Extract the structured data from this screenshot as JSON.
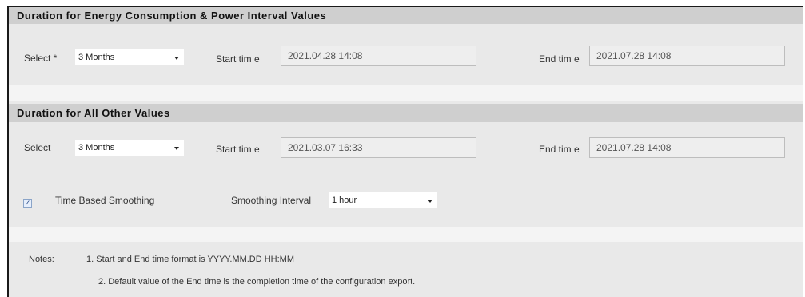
{
  "section1": {
    "title": "Duration for Energy Consumption & Power Interval Values",
    "select_label": "Select *",
    "select_value": "3 Months",
    "start_label": "Start tim e",
    "start_value": "2021.04.28 14:08",
    "end_label": "End tim e",
    "end_value": "2021.07.28 14:08"
  },
  "section2": {
    "title": "Duration for All Other Values",
    "select_label": "Select",
    "select_value": "3 Months",
    "start_label": "Start tim e",
    "start_value": "2021.03.07 16:33",
    "end_label": "End tim e",
    "end_value": "2021.07.28 14:08",
    "smoothing_checkbox_label": "Time Based Smoothing",
    "smoothing_checked": true,
    "smoothing_interval_label": "Smoothing Interval",
    "smoothing_interval_value": "1 hour"
  },
  "notes": {
    "label": "Notes:",
    "items": [
      "1. Start and End time format is YYYY.MM.DD HH:MM",
      "2. Default value of the End time is the completion time of the configuration export."
    ]
  },
  "icons": {
    "dropdown_arrow": "chevron-down-icon",
    "checkmark": "checkmark-icon"
  }
}
